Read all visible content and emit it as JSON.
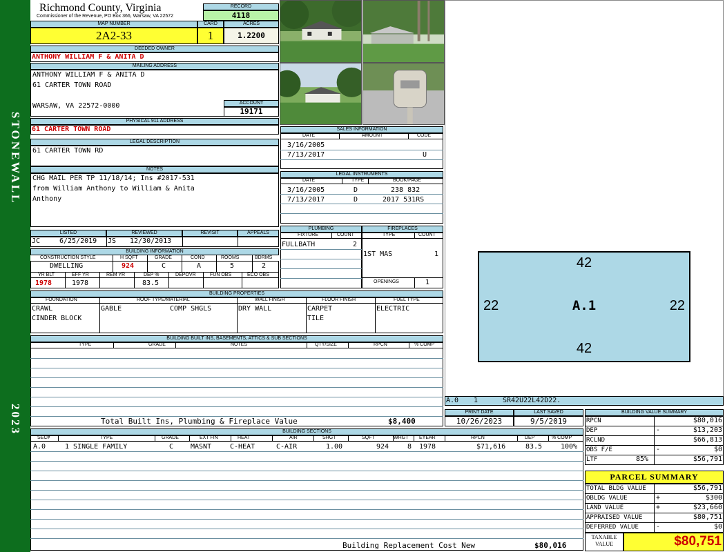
{
  "sidebar": {
    "district": "STONEWALL",
    "year": "2023"
  },
  "header": {
    "county": "Richmond County, Virginia",
    "commissioner": "Commissioner of the Revenue, PO Box 366, Warsaw, VA 22572"
  },
  "record": {
    "label": "RECORD",
    "value": "4118"
  },
  "map": {
    "map_number_label": "MAP NUMBER",
    "map_number": "2A2-33",
    "card_label": "CARD",
    "card": "1",
    "acres_label": "ACRES",
    "acres": "1.2200"
  },
  "owner": {
    "label": "DEEDED OWNER",
    "name": "ANTHONY WILLIAM F & ANITA D"
  },
  "mailing": {
    "label": "MAILING ADDRESS",
    "line1": "ANTHONY WILLIAM F & ANITA D",
    "line2": "61 CARTER TOWN ROAD",
    "line3": "WARSAW, VA 22572-0000"
  },
  "account": {
    "label": "ACCOUNT",
    "value": "19171"
  },
  "physical": {
    "label": "PHYSICAL 911 ADDRESS",
    "value": "61 CARTER TOWN ROAD"
  },
  "legal": {
    "label": "LEGAL DESCRIPTION",
    "value": "61 CARTER TOWN RD"
  },
  "notes": {
    "label": "NOTES",
    "line1": "CHG MAIL PER TP 11/18/14; Ins #2017-531",
    "line2": "from William Anthony to William & Anita",
    "line3": "Anthony"
  },
  "sales": {
    "label": "SALES INFORMATION",
    "col_date": "DATE",
    "col_amount": "AMOUNT",
    "col_code": "CODE",
    "rows": [
      {
        "date": "3/16/2005",
        "amount": "",
        "code": ""
      },
      {
        "date": "7/13/2017",
        "amount": "",
        "code": "U"
      }
    ]
  },
  "instruments": {
    "label": "LEGAL INSTRUMENTS",
    "col_date": "DATE",
    "col_type": "TYPE",
    "col_book": "BOOK/PAGE",
    "rows": [
      {
        "date": "3/16/2005",
        "type": "D",
        "book": "238 832"
      },
      {
        "date": "7/13/2017",
        "type": "D",
        "book": "2017 531RS"
      }
    ]
  },
  "review": {
    "listed_label": "LISTED",
    "reviewed_label": "REVIEWED",
    "revisit_label": "REVISIT",
    "appeals_label": "APPEALS",
    "listed_by": "JC",
    "listed_date": "6/25/2019",
    "reviewed_by": "JS",
    "reviewed_date": "12/30/2013"
  },
  "building_info": {
    "label": "BUILDING INFORMATION",
    "h_style": "CONSTRUCTION STYLE",
    "h_sqft": "H SQFT",
    "h_grade": "GRADE",
    "h_cond": "COND",
    "h_rooms": "ROOMS",
    "h_bdrms": "BDRMS",
    "style": "DWELLING",
    "sqft": "924",
    "grade": "C",
    "cond": "A",
    "rooms": "5",
    "bdrms": "2",
    "h_yrblt": "YR BLT",
    "h_effyr": "EFF YR",
    "h_remyr": "REM YR",
    "h_dep": "DEP %",
    "h_depovr": "DEPOVR",
    "h_funobs": "FUN OBS",
    "h_ecoobs": "ECO OBS",
    "yrblt": "1978",
    "effyr": "1978",
    "dep": "83.5"
  },
  "plumbing": {
    "label": "PLUMBING",
    "h_fixture": "FIXTURE",
    "h_count": "COUNT",
    "fixture": "FULLBATH",
    "count": "2"
  },
  "fireplaces": {
    "label": "FIREPLACES",
    "h_type": "TYPE",
    "h_count": "COUNT",
    "type": "1ST MAS",
    "count": "1",
    "openings_label": "OPENINGS",
    "openings": "1"
  },
  "properties": {
    "label": "BUILDING PROPERTIES",
    "h_foundation": "FOUNDATION",
    "h_roof": "ROOF TYPE/MATERIAL",
    "h_wall": "WALL FINISH",
    "h_floor": "FLOOR FINISH",
    "h_fuel": "FUEL TYPE",
    "foundation1": "CRAWL",
    "foundation2": "CINDER BLOCK",
    "roof_type": "GABLE",
    "roof_material": "COMP SHGLS",
    "wall": "DRY WALL",
    "floor1": "CARPET",
    "floor2": "TILE",
    "fuel": "ELECTRIC"
  },
  "builtins": {
    "label": "BUILDING BUILT INS, BASEMENTS, ATTICS & SUB SECTIONS",
    "h_type": "TYPE",
    "h_grade": "GRADE",
    "h_notes": "NOTES",
    "h_qty": "QTY/SIZE",
    "h_rpcn": "RPCN",
    "h_comp": "% COMP",
    "total_label": "Total Built Ins, Plumbing & Fireplace Value",
    "total": "$8,400"
  },
  "sketch": {
    "label": "A.1",
    "top": "42",
    "bottom": "42",
    "left": "22",
    "right": "22",
    "caption_sec": "A.0",
    "caption_num": "1",
    "caption_code": "SR42U22L42D22."
  },
  "dates": {
    "print_label": "PRINT DATE",
    "print": "10/26/2023",
    "saved_label": "LAST SAVED",
    "saved": "9/5/2019"
  },
  "sections": {
    "label": "BUILDING SECTIONS",
    "h_sec": "SEC#",
    "h_type": "TYPE",
    "h_grade": "GRADE",
    "h_ext": "EXT FIN",
    "h_heat": "HEAT",
    "h_air": "AIR",
    "h_shgt": "SHGT",
    "h_sqft": "SQFT",
    "h_whgt": "WHGT",
    "h_eyear": "EYEAR",
    "h_rpcn": "RPCN",
    "h_dep": "DEP",
    "h_comp": "% COMP",
    "row": {
      "sec": "A.0",
      "type": "1 SINGLE FAMILY",
      "grade": "C",
      "ext": "MASNT",
      "heat": "C-HEAT",
      "air": "C-AIR",
      "shgt": "1.00",
      "sqft": "924",
      "whgt": "8",
      "eyear": "1978",
      "rpcn": "$71,616",
      "dep": "83.5",
      "comp": "100%"
    },
    "replacement_label": "Building Replacement Cost New",
    "replacement": "$80,016"
  },
  "value_summary": {
    "label": "BUILDING VALUE SUMMARY",
    "rows": [
      {
        "k": "RPCN",
        "sign": "",
        "v": "$80,016"
      },
      {
        "k": "DEP",
        "sign": "-",
        "v": "$13,203"
      },
      {
        "k": "RCLND",
        "sign": "",
        "v": "$66,813"
      },
      {
        "k": "OBS F/E",
        "sign": "-",
        "v": "$0"
      },
      {
        "k": "LTF",
        "pct": "85%",
        "sign": "",
        "v": "$56,791"
      }
    ]
  },
  "parcel": {
    "label": "PARCEL SUMMARY",
    "rows": [
      {
        "k": "TOTAL BLDG VALUE",
        "sign": "",
        "v": "$56,791"
      },
      {
        "k": "OBLDG VALUE",
        "sign": "+",
        "v": "$300"
      },
      {
        "k": "LAND VALUE",
        "sign": "+",
        "v": "$23,660"
      },
      {
        "k": "APPRAISED VALUE",
        "sign": "",
        "v": "$80,751"
      },
      {
        "k": "DEFERRED VALUE",
        "sign": "-",
        "v": "$0"
      }
    ],
    "taxable_label1": "TAXABLE",
    "taxable_label2": "VALUE",
    "taxable": "$80,751"
  },
  "colors": {
    "sidebar": "#0d6e1e",
    "header": "#add8e6",
    "highlight": "#ffff33",
    "record": "#b9f3a8",
    "sketch": "#add8e6",
    "red": "#cc0000"
  },
  "photos": [
    "house-front-photo",
    "carport-photo",
    "house-yard-photo",
    "mailbox-photo"
  ]
}
